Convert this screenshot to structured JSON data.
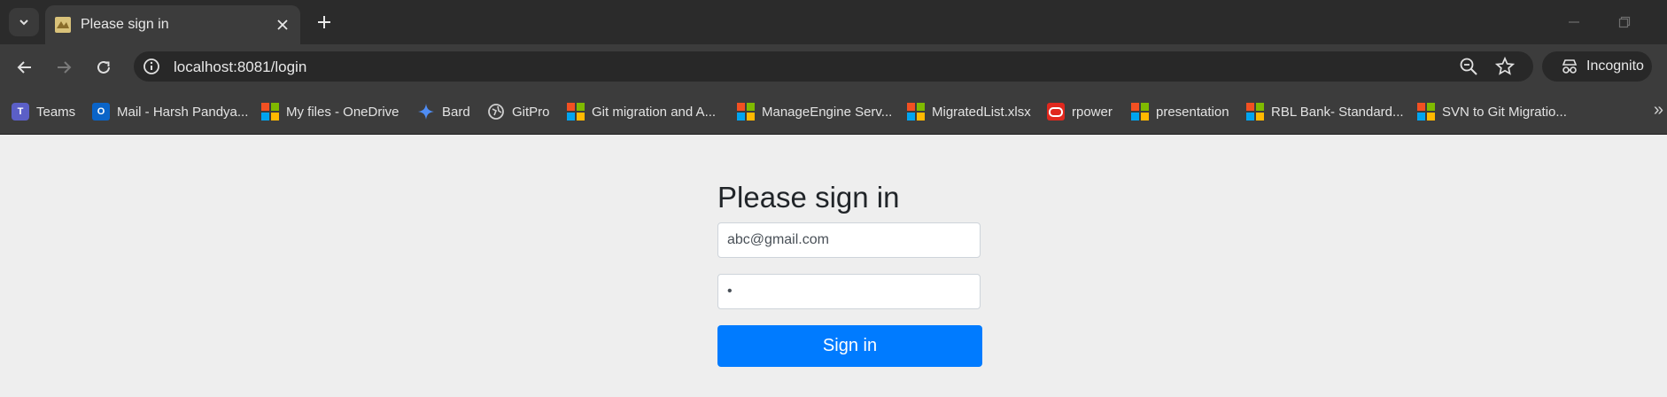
{
  "browser": {
    "tab": {
      "title": "Please sign in"
    },
    "address_bar": {
      "url": "localhost:8081/login"
    },
    "profile": {
      "label": "Incognito"
    },
    "bookmarks": [
      {
        "label": "Teams",
        "icon": "teams-icon"
      },
      {
        "label": "Mail - Harsh Pandya...",
        "icon": "outlook-icon"
      },
      {
        "label": "My files - OneDrive",
        "icon": "microsoft-icon"
      },
      {
        "label": "Bard",
        "icon": "bard-icon"
      },
      {
        "label": "GitPro",
        "icon": "globe-icon"
      },
      {
        "label": "Git migration and A...",
        "icon": "microsoft-icon"
      },
      {
        "label": "ManageEngine Serv...",
        "icon": "microsoft-icon"
      },
      {
        "label": "MigratedList.xlsx",
        "icon": "microsoft-icon"
      },
      {
        "label": "rpower",
        "icon": "oracle-icon"
      },
      {
        "label": "presentation",
        "icon": "microsoft-icon"
      },
      {
        "label": "RBL Bank- Standard...",
        "icon": "microsoft-icon"
      },
      {
        "label": "SVN to Git Migratio...",
        "icon": "microsoft-icon"
      }
    ],
    "bookmarks_overflow": "»"
  },
  "login": {
    "heading": "Please sign in",
    "email_value": "abc@gmail.com",
    "password_value": "•",
    "button_label": "Sign in"
  },
  "colors": {
    "tabbar": "#2b2b2b",
    "toolbar": "#3c3c3c",
    "page_background": "#eeeeee",
    "primary_button": "#007bff"
  }
}
